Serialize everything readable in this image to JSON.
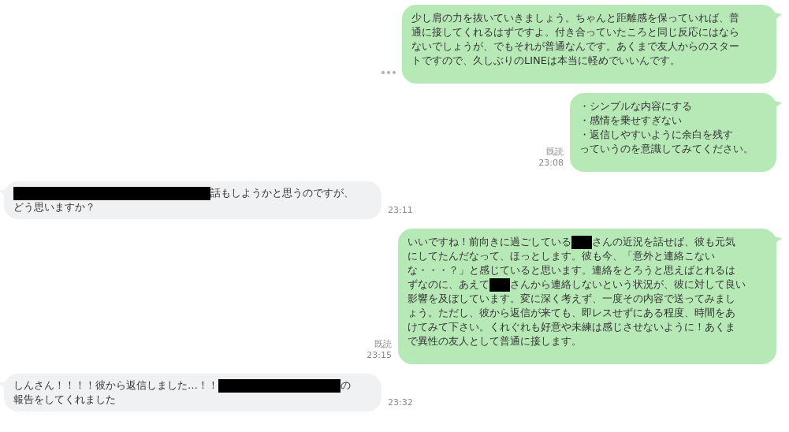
{
  "messages": [
    {
      "outgoing": true,
      "menu": true,
      "lines": [
        [
          {
            "kind": "text",
            "text": "少し肩の力を抜いていきましょう。ちゃんと距離感を保っていれば、普"
          }
        ],
        [
          {
            "kind": "text",
            "text": "通に接してくれるはずですよ。付き合っていたころと同じ反応にはなら"
          }
        ],
        [
          {
            "kind": "text",
            "text": "ないでしょうが、でもそれが普通なんです。あくまで友人からのスター"
          }
        ],
        [
          {
            "kind": "text",
            "text": "トですので、久しぶりのLINEは本当に軽めでいいんです。"
          }
        ]
      ]
    },
    {
      "outgoing": true,
      "menu": false,
      "read_label": "既読",
      "time": "23:08",
      "lines": [
        [
          {
            "kind": "text",
            "text": "・シンプルな内容にする"
          }
        ],
        [
          {
            "kind": "text",
            "text": "・感情を乗せすぎない"
          }
        ],
        [
          {
            "kind": "text",
            "text": "・返信しやすいように余白を残す"
          }
        ],
        [
          {
            "kind": "text",
            "text": "っていうのを意識してみてください。"
          }
        ]
      ]
    },
    {
      "outgoing": false,
      "menu": false,
      "time": "23:11",
      "lines": [
        [
          {
            "kind": "redaction-wide"
          },
          {
            "kind": "text",
            "text": "話もしようかと思うのですが、"
          }
        ],
        [
          {
            "kind": "text",
            "text": "どう思いますか？"
          }
        ]
      ]
    },
    {
      "outgoing": true,
      "menu": false,
      "read_label": "既読",
      "time": "23:15",
      "lines": [
        [
          {
            "kind": "text",
            "text": "いいですね！前向きに過ごしている"
          },
          {
            "kind": "redaction-narrow"
          },
          {
            "kind": "text",
            "text": "さんの近況を話せば、彼も元気"
          }
        ],
        [
          {
            "kind": "text",
            "text": "にしてたんだなって、ほっとします。彼も今、「意外と連絡こない"
          }
        ],
        [
          {
            "kind": "text",
            "text": "な・・・？」と感じていると思います。連絡をとろうと思えばとれるは"
          }
        ],
        [
          {
            "kind": "text",
            "text": "ずなのに、あえて"
          },
          {
            "kind": "redaction-narrow"
          },
          {
            "kind": "text",
            "text": "さんから連絡しないという状況が、彼に対して良い"
          }
        ],
        [
          {
            "kind": "text",
            "text": "影響を及ぼしています。変に深く考えず、一度その内容で送ってみまし"
          }
        ],
        [
          {
            "kind": "text",
            "text": "ょう。ただし、彼から返信が来ても、即レスせずにある程度、時間をあ"
          }
        ],
        [
          {
            "kind": "text",
            "text": "けてみて下さい。くれぐれも好意や未練は感じさせないように！あくま"
          }
        ],
        [
          {
            "kind": "text",
            "text": "で異性の友人として普通に接します。"
          }
        ]
      ]
    },
    {
      "outgoing": false,
      "menu": false,
      "time": "23:32",
      "lines": [
        [
          {
            "kind": "text",
            "text": "しんさん！！！！彼から返信しました…！！"
          },
          {
            "kind": "redaction-medium"
          },
          {
            "kind": "text",
            "text": "の"
          }
        ],
        [
          {
            "kind": "text",
            "text": "報告をしてくれました"
          }
        ]
      ]
    }
  ]
}
